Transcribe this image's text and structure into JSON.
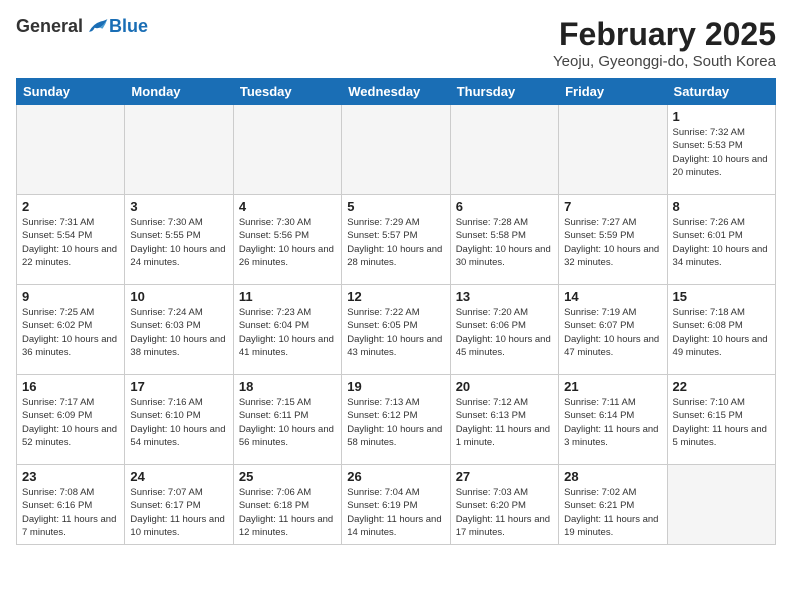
{
  "header": {
    "logo": {
      "general": "General",
      "blue": "Blue"
    },
    "title": "February 2025",
    "subtitle": "Yeoju, Gyeonggi-do, South Korea"
  },
  "days_of_week": [
    "Sunday",
    "Monday",
    "Tuesday",
    "Wednesday",
    "Thursday",
    "Friday",
    "Saturday"
  ],
  "weeks": [
    [
      {
        "day": "",
        "info": ""
      },
      {
        "day": "",
        "info": ""
      },
      {
        "day": "",
        "info": ""
      },
      {
        "day": "",
        "info": ""
      },
      {
        "day": "",
        "info": ""
      },
      {
        "day": "",
        "info": ""
      },
      {
        "day": "1",
        "info": "Sunrise: 7:32 AM\nSunset: 5:53 PM\nDaylight: 10 hours and 20 minutes."
      }
    ],
    [
      {
        "day": "2",
        "info": "Sunrise: 7:31 AM\nSunset: 5:54 PM\nDaylight: 10 hours and 22 minutes."
      },
      {
        "day": "3",
        "info": "Sunrise: 7:30 AM\nSunset: 5:55 PM\nDaylight: 10 hours and 24 minutes."
      },
      {
        "day": "4",
        "info": "Sunrise: 7:30 AM\nSunset: 5:56 PM\nDaylight: 10 hours and 26 minutes."
      },
      {
        "day": "5",
        "info": "Sunrise: 7:29 AM\nSunset: 5:57 PM\nDaylight: 10 hours and 28 minutes."
      },
      {
        "day": "6",
        "info": "Sunrise: 7:28 AM\nSunset: 5:58 PM\nDaylight: 10 hours and 30 minutes."
      },
      {
        "day": "7",
        "info": "Sunrise: 7:27 AM\nSunset: 5:59 PM\nDaylight: 10 hours and 32 minutes."
      },
      {
        "day": "8",
        "info": "Sunrise: 7:26 AM\nSunset: 6:01 PM\nDaylight: 10 hours and 34 minutes."
      }
    ],
    [
      {
        "day": "9",
        "info": "Sunrise: 7:25 AM\nSunset: 6:02 PM\nDaylight: 10 hours and 36 minutes."
      },
      {
        "day": "10",
        "info": "Sunrise: 7:24 AM\nSunset: 6:03 PM\nDaylight: 10 hours and 38 minutes."
      },
      {
        "day": "11",
        "info": "Sunrise: 7:23 AM\nSunset: 6:04 PM\nDaylight: 10 hours and 41 minutes."
      },
      {
        "day": "12",
        "info": "Sunrise: 7:22 AM\nSunset: 6:05 PM\nDaylight: 10 hours and 43 minutes."
      },
      {
        "day": "13",
        "info": "Sunrise: 7:20 AM\nSunset: 6:06 PM\nDaylight: 10 hours and 45 minutes."
      },
      {
        "day": "14",
        "info": "Sunrise: 7:19 AM\nSunset: 6:07 PM\nDaylight: 10 hours and 47 minutes."
      },
      {
        "day": "15",
        "info": "Sunrise: 7:18 AM\nSunset: 6:08 PM\nDaylight: 10 hours and 49 minutes."
      }
    ],
    [
      {
        "day": "16",
        "info": "Sunrise: 7:17 AM\nSunset: 6:09 PM\nDaylight: 10 hours and 52 minutes."
      },
      {
        "day": "17",
        "info": "Sunrise: 7:16 AM\nSunset: 6:10 PM\nDaylight: 10 hours and 54 minutes."
      },
      {
        "day": "18",
        "info": "Sunrise: 7:15 AM\nSunset: 6:11 PM\nDaylight: 10 hours and 56 minutes."
      },
      {
        "day": "19",
        "info": "Sunrise: 7:13 AM\nSunset: 6:12 PM\nDaylight: 10 hours and 58 minutes."
      },
      {
        "day": "20",
        "info": "Sunrise: 7:12 AM\nSunset: 6:13 PM\nDaylight: 11 hours and 1 minute."
      },
      {
        "day": "21",
        "info": "Sunrise: 7:11 AM\nSunset: 6:14 PM\nDaylight: 11 hours and 3 minutes."
      },
      {
        "day": "22",
        "info": "Sunrise: 7:10 AM\nSunset: 6:15 PM\nDaylight: 11 hours and 5 minutes."
      }
    ],
    [
      {
        "day": "23",
        "info": "Sunrise: 7:08 AM\nSunset: 6:16 PM\nDaylight: 11 hours and 7 minutes."
      },
      {
        "day": "24",
        "info": "Sunrise: 7:07 AM\nSunset: 6:17 PM\nDaylight: 11 hours and 10 minutes."
      },
      {
        "day": "25",
        "info": "Sunrise: 7:06 AM\nSunset: 6:18 PM\nDaylight: 11 hours and 12 minutes."
      },
      {
        "day": "26",
        "info": "Sunrise: 7:04 AM\nSunset: 6:19 PM\nDaylight: 11 hours and 14 minutes."
      },
      {
        "day": "27",
        "info": "Sunrise: 7:03 AM\nSunset: 6:20 PM\nDaylight: 11 hours and 17 minutes."
      },
      {
        "day": "28",
        "info": "Sunrise: 7:02 AM\nSunset: 6:21 PM\nDaylight: 11 hours and 19 minutes."
      },
      {
        "day": "",
        "info": ""
      }
    ]
  ]
}
